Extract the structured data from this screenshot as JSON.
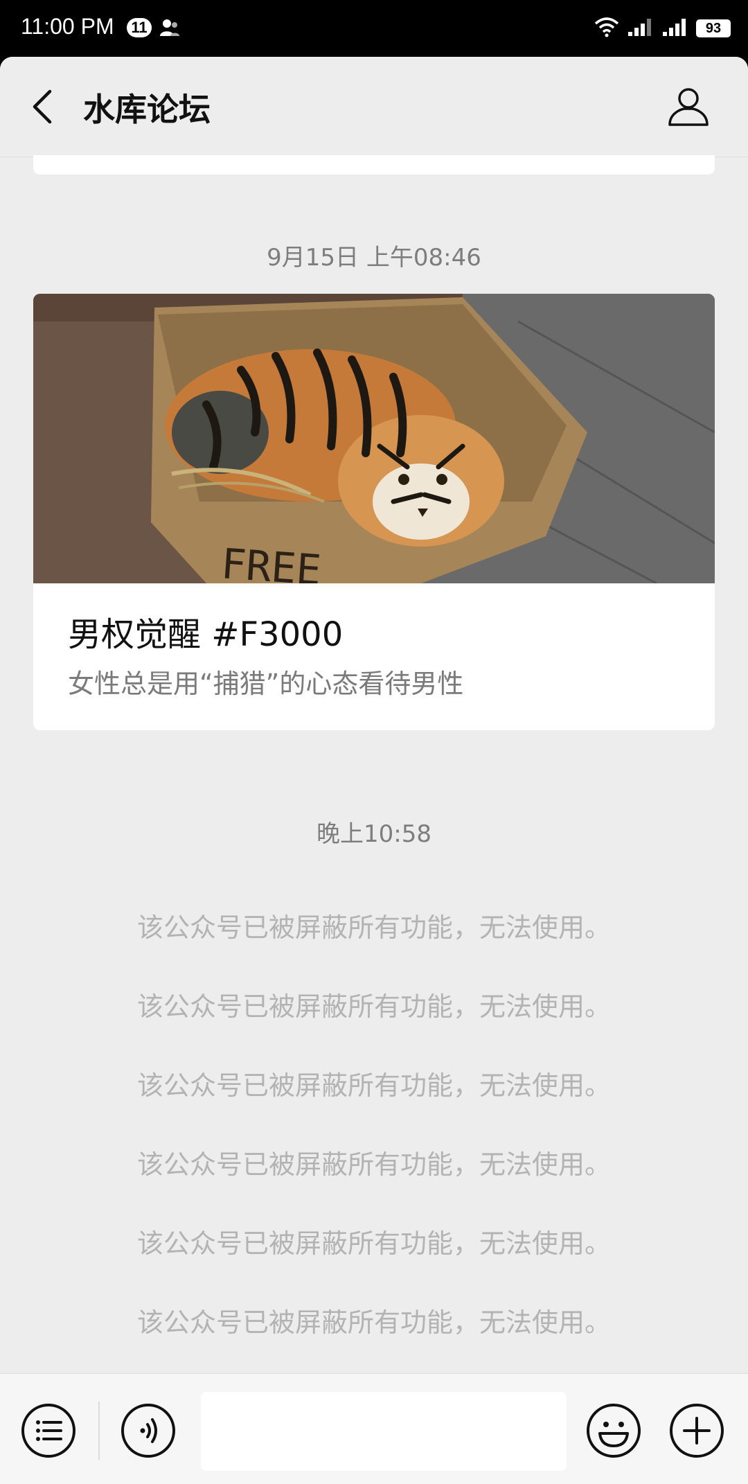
{
  "status_bar": {
    "time": "11:00 PM",
    "notification_count": "11",
    "battery": "93"
  },
  "header": {
    "title": "水库论坛"
  },
  "messages": {
    "timestamp_1": "9月15日 上午08:46",
    "article": {
      "title": "男权觉醒 #F3000",
      "description": "女性总是用“捕猎”的心态看待男性",
      "image_text": "FREE"
    },
    "timestamp_2": "晚上10:58",
    "notices": [
      "该公众号已被屏蔽所有功能，无法使用。",
      "该公众号已被屏蔽所有功能，无法使用。",
      "该公众号已被屏蔽所有功能，无法使用。",
      "该公众号已被屏蔽所有功能，无法使用。",
      "该公众号已被屏蔽所有功能，无法使用。",
      "该公众号已被屏蔽所有功能，无法使用。"
    ]
  },
  "input_bar": {
    "input_value": ""
  },
  "colors": {
    "background": "#ededed",
    "card": "#ffffff",
    "notice_text": "#b3b3b3",
    "timestamp_text": "#7d7d7d"
  },
  "icons": [
    "back-icon",
    "profile-icon",
    "menu-list-icon",
    "voice-icon",
    "emoji-icon",
    "plus-icon"
  ]
}
